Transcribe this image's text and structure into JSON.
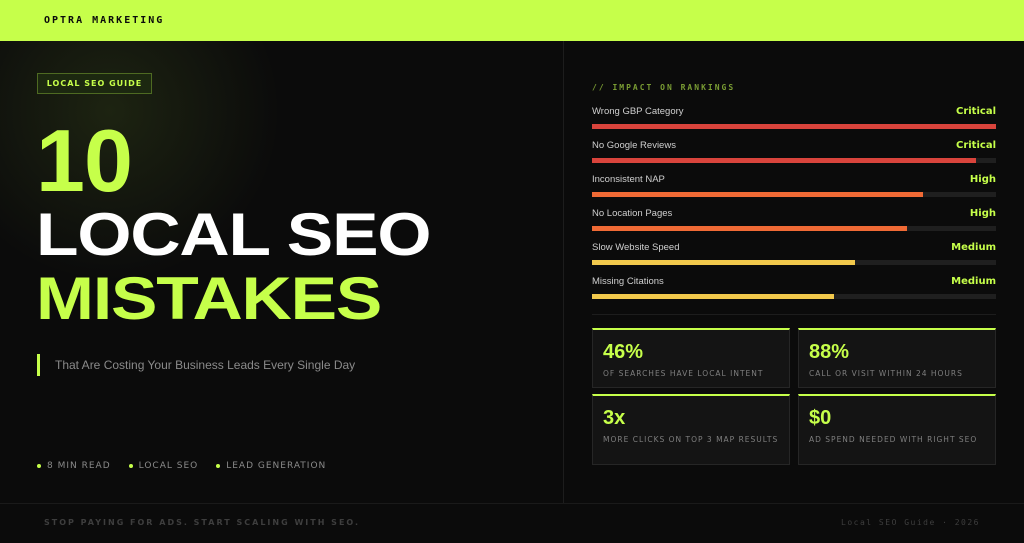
{
  "brand": "OPTRA MARKETING",
  "colors": {
    "accent": "#c6ff4a",
    "critical": "#d9443c",
    "high": "#f06a35",
    "medium": "#f2c94c",
    "background": "#0b0b0b"
  },
  "hero": {
    "tag": "LOCAL SEO GUIDE",
    "title_number": "10",
    "title_line1": "LOCAL SEO",
    "title_line2": "MISTAKES",
    "subtitle": "That Are Costing Your Business Leads Every Single Day",
    "meta": [
      "8 MIN READ",
      "LOCAL SEO",
      "LEAD GENERATION"
    ]
  },
  "rankings": {
    "label": "// IMPACT ON RANKINGS",
    "items": [
      {
        "name": "Wrong GBP Category",
        "level": "Critical",
        "severity": "critical",
        "impact": 1.0
      },
      {
        "name": "No Google Reviews",
        "level": "Critical",
        "severity": "critical",
        "impact": 0.95
      },
      {
        "name": "Inconsistent NAP",
        "level": "High",
        "severity": "high",
        "impact": 0.82
      },
      {
        "name": "No Location Pages",
        "level": "High",
        "severity": "high",
        "impact": 0.78
      },
      {
        "name": "Slow Website Speed",
        "level": "Medium",
        "severity": "medium",
        "impact": 0.65
      },
      {
        "name": "Missing Citations",
        "level": "Medium",
        "severity": "medium",
        "impact": 0.6
      }
    ]
  },
  "stats": [
    {
      "value": "46%",
      "desc": "OF SEARCHES HAVE LOCAL INTENT"
    },
    {
      "value": "88%",
      "desc": "CALL OR VISIT WITHIN 24 HOURS"
    },
    {
      "value": "3x",
      "desc": "MORE CLICKS ON TOP 3 MAP RESULTS"
    },
    {
      "value": "$0",
      "desc": "AD SPEND NEEDED WITH RIGHT SEO"
    }
  ],
  "footer": {
    "left": "STOP PAYING FOR ADS. START SCALING WITH SEO.",
    "right": "Local SEO Guide · 2026"
  }
}
